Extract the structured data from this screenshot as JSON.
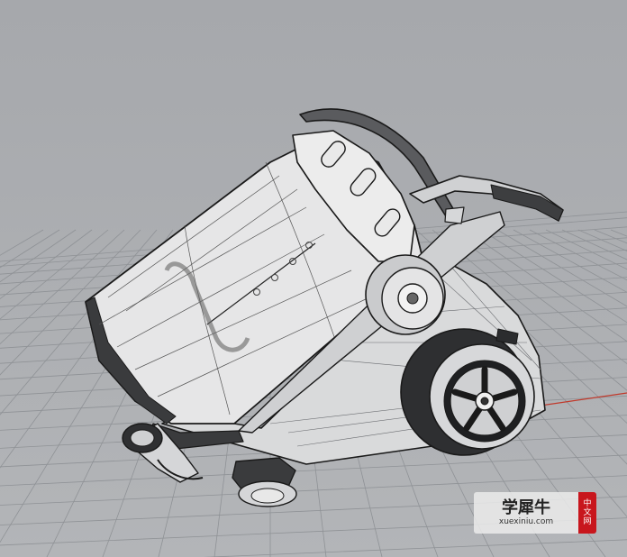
{
  "viewport": {
    "background": "#aaacb0",
    "grid_color": "#8f9296",
    "axis_color": "#c0392b",
    "model": "vacuum-cleaner-wireframe"
  },
  "watermark": {
    "title": "学犀牛",
    "domain": "xuexiniu.com",
    "badge": [
      "中",
      "文",
      "网"
    ],
    "badge_color": "#c8161d"
  }
}
